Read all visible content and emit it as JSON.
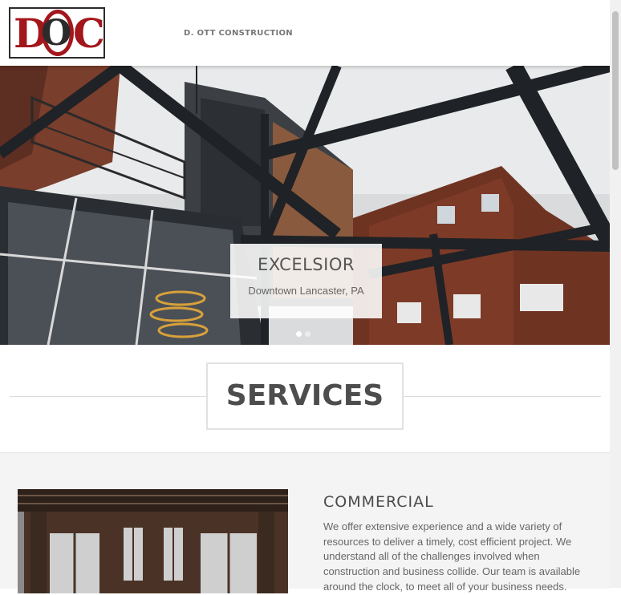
{
  "header": {
    "logo_letters": [
      "D",
      "O",
      "C"
    ],
    "brand_name": "D. OTT CONSTRUCTION"
  },
  "hero": {
    "title": "EXCELSIOR",
    "subtitle": "Downtown Lancaster, PA",
    "slide_count": 2,
    "active_slide": 1
  },
  "services": {
    "heading": "SERVICES"
  },
  "commercial": {
    "title": "COMMERCIAL",
    "description": "We offer extensive experience and a wide variety of resources to deliver a timely, cost efficient project. We understand all of the challenges involved when construction and business collide. Our team is available around the clock, to meet all of your business needs."
  },
  "colors": {
    "brand_red": "#a3161b",
    "text_dark": "#4d4d4d",
    "section_bg": "#f4f4f4"
  }
}
